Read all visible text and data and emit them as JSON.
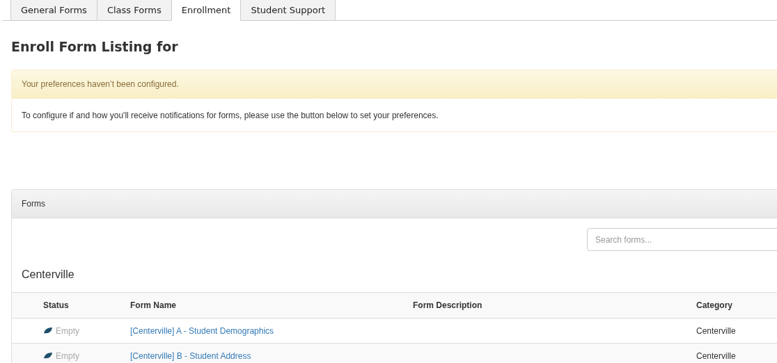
{
  "tabs": [
    {
      "label": "General Forms",
      "selected": false
    },
    {
      "label": "Class Forms",
      "selected": false
    },
    {
      "label": "Enrollment",
      "selected": true
    },
    {
      "label": "Student Support",
      "selected": false
    }
  ],
  "heading": "Enroll Form Listing for",
  "alert": {
    "title": "Your preferences haven’t been configured.",
    "message": "To configure if and how you'll receive notifications for forms, please use the button below to set your preferences."
  },
  "panel": {
    "title": "Forms",
    "search": {
      "placeholder": "Search forms..."
    },
    "group": "Centerville",
    "table": {
      "columns": [
        "Status",
        "Form Name",
        "Form Description",
        "Category"
      ],
      "rows": [
        {
          "status": "Empty",
          "name": "[Centerville] A - Student Demographics",
          "category": "Centerville"
        },
        {
          "status": "Empty",
          "name": "[Centerville] B - Student Address",
          "category": "Centerville"
        }
      ]
    }
  }
}
